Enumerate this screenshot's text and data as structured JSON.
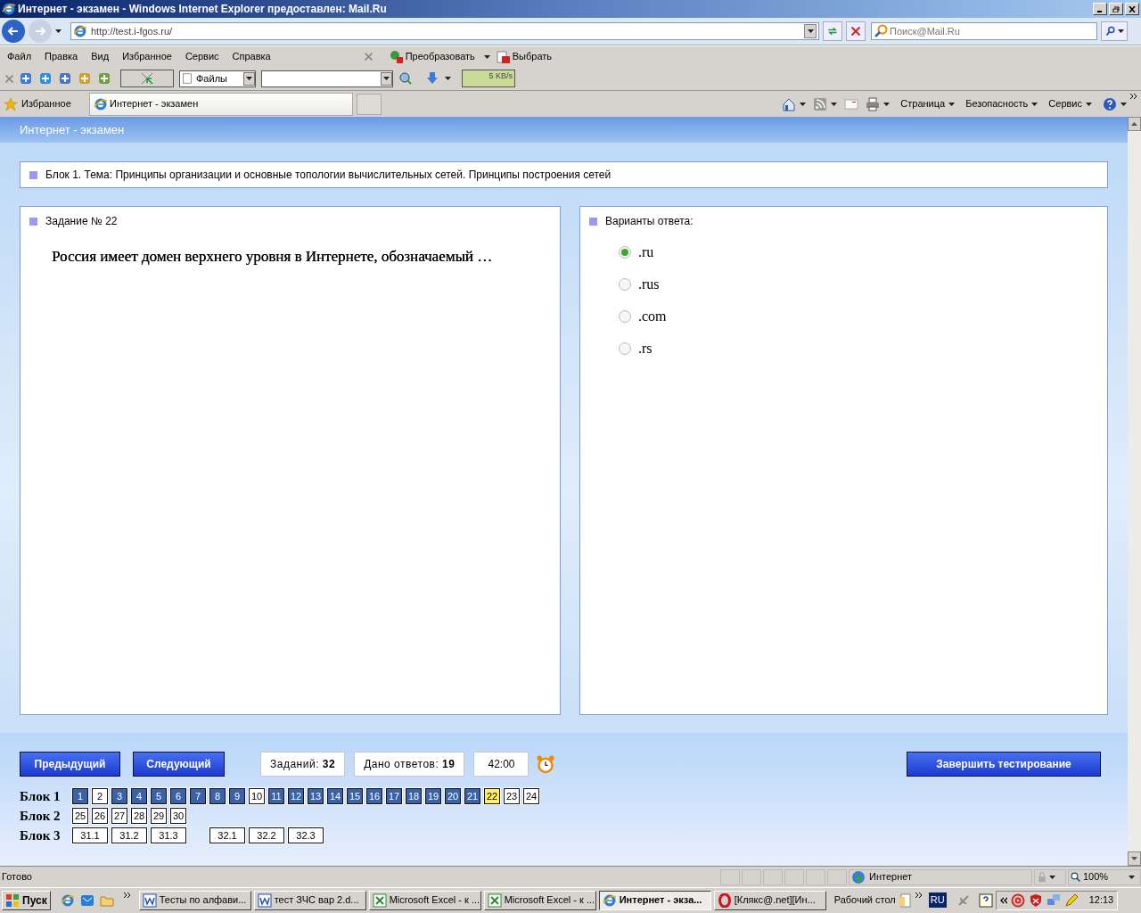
{
  "title_bar": {
    "title": "Интернет - экзамен - Windows Internet Explorer предоставлен: Mail.Ru"
  },
  "address_bar": {
    "url": "http://test.i-fgos.ru/",
    "search_placeholder": "Поиск@Mail.Ru"
  },
  "menu": [
    "Файл",
    "Правка",
    "Вид",
    "Избранное",
    "Сервис",
    "Справка"
  ],
  "toolbar": {
    "convert_label": "Преобразовать",
    "select_label": "Выбрать",
    "files_dropdown": "Файлы",
    "speed": "5 KB/s"
  },
  "favorites_bar": {
    "favorites_label": "Избранное",
    "tab_title": "Интернет - экзамен",
    "commands": [
      "Страница",
      "Безопасность",
      "Сервис"
    ]
  },
  "page": {
    "header": "Интернет - экзамен",
    "block_title": "Блок 1. Тема: Принципы организации и основные топологии вычислительных сетей. Принципы построения сетей",
    "task": {
      "label": "Задание № 22",
      "question": "Россия имеет домен верхнего уровня в Интернете, обозначаемый …"
    },
    "answers": {
      "label": "Варианты ответа:",
      "options": [
        {
          "text": ".ru",
          "selected": true
        },
        {
          "text": ".rus",
          "selected": false
        },
        {
          "text": ".com",
          "selected": false
        },
        {
          "text": ".rs",
          "selected": false
        }
      ]
    },
    "nav": {
      "prev": "Предыдущий",
      "next": "Следующий",
      "counters": [
        "Заданий: **32**",
        "Дано ответов: **19**"
      ],
      "timer": "42:00",
      "finish": "Завершить тестирование"
    },
    "blocks": [
      {
        "label": "Блок 1",
        "groups": [
          [
            {
              "number": "1",
              "answered": true,
              "selected": false
            },
            {
              "number": "2",
              "answered": false,
              "selected": false
            },
            {
              "number": "3",
              "answered": true,
              "selected": false
            },
            {
              "number": "4",
              "answered": true,
              "selected": false
            },
            {
              "number": "5",
              "answered": true,
              "selected": false
            },
            {
              "number": "6",
              "answered": true,
              "selected": false
            },
            {
              "number": "7",
              "answered": true,
              "selected": false
            },
            {
              "number": "8",
              "answered": true,
              "selected": false
            },
            {
              "number": "9",
              "answered": true,
              "selected": false
            },
            {
              "number": "10",
              "answered": false,
              "selected": false
            },
            {
              "number": "11",
              "answered": true,
              "selected": false
            },
            {
              "number": "12",
              "answered": true,
              "selected": false
            },
            {
              "number": "13",
              "answered": true,
              "selected": false
            },
            {
              "number": "14",
              "answered": true,
              "selected": false
            },
            {
              "number": "15",
              "answered": true,
              "selected": false
            },
            {
              "number": "16",
              "answered": true,
              "selected": false
            },
            {
              "number": "17",
              "answered": true,
              "selected": false
            },
            {
              "number": "18",
              "answered": true,
              "selected": false
            },
            {
              "number": "19",
              "answered": true,
              "selected": false
            },
            {
              "number": "20",
              "answered": true,
              "selected": false
            },
            {
              "number": "21",
              "answered": true,
              "selected": false
            },
            {
              "number": "22",
              "answered": false,
              "selected": true
            },
            {
              "number": "23",
              "answered": false,
              "selected": false
            },
            {
              "number": "24",
              "answered": false,
              "selected": false
            }
          ]
        ]
      },
      {
        "label": "Блок 2",
        "groups": [
          [
            {
              "number": "25",
              "answered": false,
              "selected": false
            },
            {
              "number": "26",
              "answered": false,
              "selected": false
            },
            {
              "number": "27",
              "answered": false,
              "selected": false
            },
            {
              "number": "28",
              "answered": false,
              "selected": false
            },
            {
              "number": "29",
              "answered": false,
              "selected": false
            },
            {
              "number": "30",
              "answered": false,
              "selected": false
            }
          ]
        ]
      },
      {
        "label": "Блок 3",
        "groups": [
          [
            {
              "number": "31.1",
              "answered": false,
              "selected": false
            },
            {
              "number": "31.2",
              "answered": false,
              "selected": false
            },
            {
              "number": "31.3",
              "answered": false,
              "selected": false
            }
          ],
          [
            {
              "number": "32.1",
              "answered": false,
              "selected": false
            },
            {
              "number": "32.2",
              "answered": false,
              "selected": false
            },
            {
              "number": "32.3",
              "answered": false,
              "selected": false
            }
          ]
        ]
      }
    ]
  },
  "status_bar": {
    "text": "Готово",
    "zone": "Интернет",
    "zoom": "100%"
  },
  "taskbar": {
    "start": "Пуск",
    "tasks": [
      {
        "label": "Тесты по алфави...",
        "kind": "word",
        "selected": false
      },
      {
        "label": "тест ЗЧС вар 2.d...",
        "kind": "word",
        "selected": false
      },
      {
        "label": "Microsoft Excel - к ...",
        "kind": "excel",
        "selected": false
      },
      {
        "label": "Microsoft Excel - к ...",
        "kind": "excel",
        "selected": false
      },
      {
        "label": "Интернет - экза...",
        "kind": "ie",
        "selected": true
      },
      {
        "label": "[Клякс@.net][Ин...",
        "kind": "opera",
        "selected": false
      }
    ],
    "desktop_label": "Рабочий стол",
    "lang": "RU",
    "clock": "12:13"
  }
}
